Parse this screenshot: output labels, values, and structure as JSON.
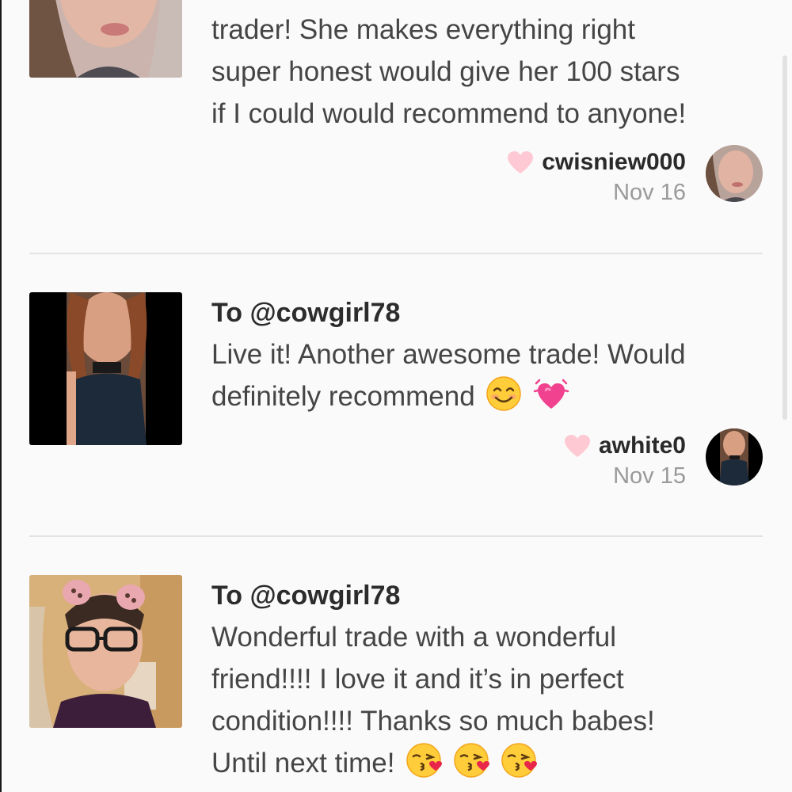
{
  "reviews": [
    {
      "lines": [
        "trader! She makes everything right",
        "super honest would give her 100 stars",
        "if I could would recommend to anyone!"
      ],
      "username": "cwisniew000",
      "date": "Nov 16"
    },
    {
      "to": "To @cowgirl78",
      "lines": [
        "Live it! Another awesome trade! Would",
        "definitely recommend"
      ],
      "username": "awhite0",
      "date": "Nov 15"
    },
    {
      "to": "To @cowgirl78",
      "lines": [
        "Wonderful trade with a wonderful",
        "friend!!!! I love it and it’s in perfect",
        "condition!!!! Thanks so much babes!",
        "Until next time!"
      ]
    }
  ],
  "colors": {
    "background": "#fafafa",
    "heart": "#ffc9d3",
    "divider": "#e3e3e3",
    "date": "#9a9a9a"
  },
  "icons": {
    "heart": "heart-icon",
    "smile": "smiling-face-emoji",
    "growing_heart": "growing-heart-emoji",
    "kiss": "kissing-face-emoji"
  }
}
